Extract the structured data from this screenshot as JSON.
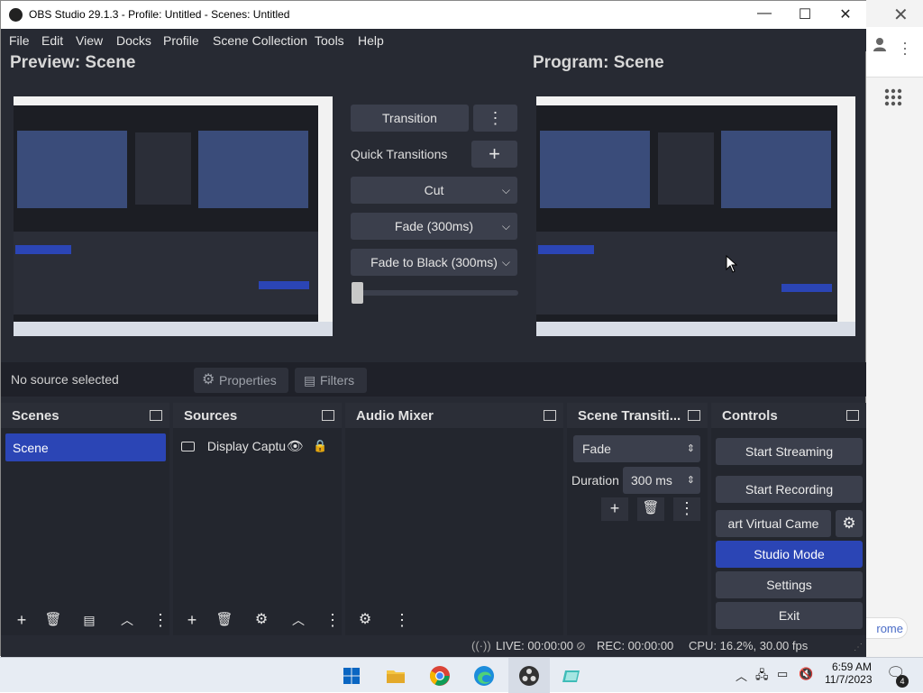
{
  "window": {
    "title": "OBS Studio 29.1.3 - Profile: Untitled - Scenes: Untitled",
    "minimize": "—",
    "maximize": "☐",
    "close": "✕"
  },
  "menu": [
    "File",
    "Edit",
    "View",
    "Docks",
    "Profile",
    "Scene Collection",
    "Tools",
    "Help"
  ],
  "preview": {
    "title": "Preview: Scene"
  },
  "program": {
    "title": "Program: Scene"
  },
  "transition": {
    "button": "Transition",
    "quick_label": "Quick Transitions",
    "quick_add": "+",
    "options": [
      "Cut",
      "Fade (300ms)",
      "Fade to Black (300ms)"
    ]
  },
  "source_bar": {
    "no_source": "No source selected",
    "properties": "Properties",
    "filters": "Filters"
  },
  "docks": {
    "scenes": {
      "title": "Scenes",
      "items": [
        "Scene"
      ]
    },
    "sources": {
      "title": "Sources",
      "items": [
        "Display Captu"
      ]
    },
    "audio": {
      "title": "Audio Mixer"
    },
    "transitions": {
      "title": "Scene Transiti...",
      "selected": "Fade",
      "duration_label": "Duration",
      "duration_value": "300 ms"
    },
    "controls": {
      "title": "Controls",
      "buttons": [
        "Start Streaming",
        "Start Recording",
        "art Virtual Came",
        "Studio Mode",
        "Settings",
        "Exit"
      ]
    }
  },
  "status": {
    "live": "LIVE: 00:00:00",
    "rec": "REC: 00:00:00",
    "cpu": "CPU: 16.2%, 30.00 fps"
  },
  "taskbar": {
    "time": "6:59 AM",
    "date": "11/7/2023",
    "notif_count": "4"
  },
  "chrome": {
    "label": "rome",
    "close": "✕"
  },
  "colors": {
    "obs_bg": "#272a33",
    "accent": "#2b45b5",
    "button": "#3b3f4c"
  }
}
